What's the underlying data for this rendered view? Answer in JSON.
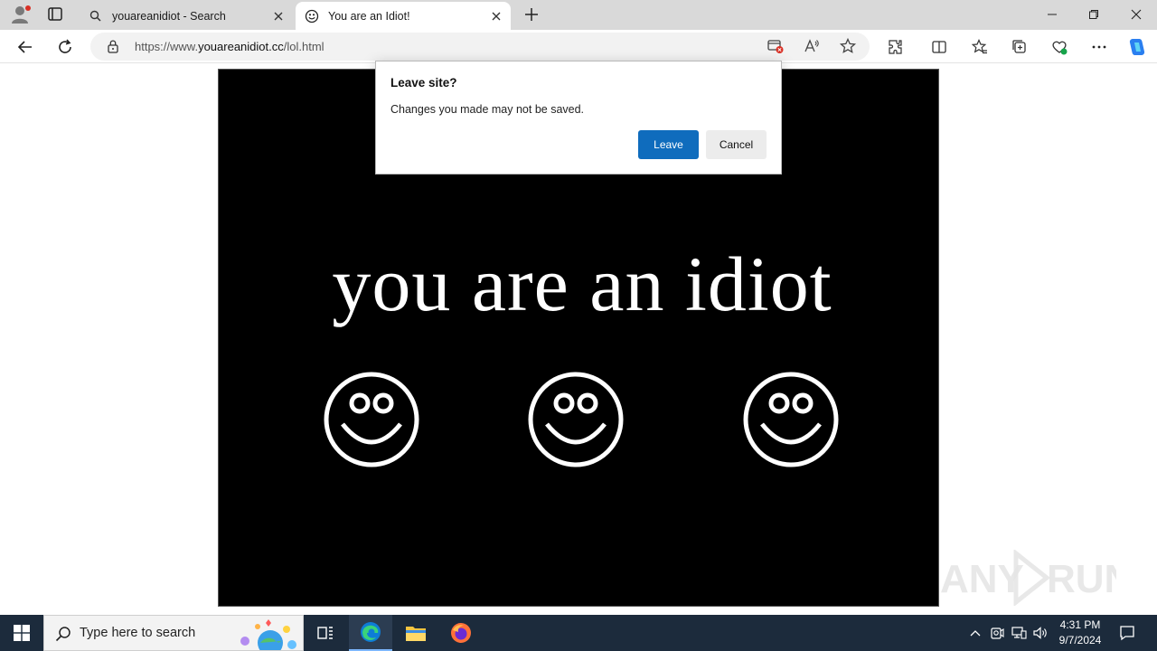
{
  "browser": {
    "tabs": [
      {
        "title": "youareanidiot - Search",
        "icon": "search-icon"
      },
      {
        "title": "You are an Idiot!",
        "icon": "smiley-icon"
      }
    ],
    "address": {
      "prefix": "https://www.",
      "host": "youareanidiot.cc",
      "path": "/lol.html"
    }
  },
  "page": {
    "headline": "you are an idiot",
    "background": "#000000",
    "foreground": "#ffffff"
  },
  "dialog": {
    "title": "Leave site?",
    "message": "Changes you made may not be saved.",
    "leave_label": "Leave",
    "cancel_label": "Cancel",
    "accent": "#0f6cbd"
  },
  "taskbar": {
    "search_placeholder": "Type here to search",
    "time": "4:31 PM",
    "date": "9/7/2024"
  },
  "watermark": "ANY RUN"
}
